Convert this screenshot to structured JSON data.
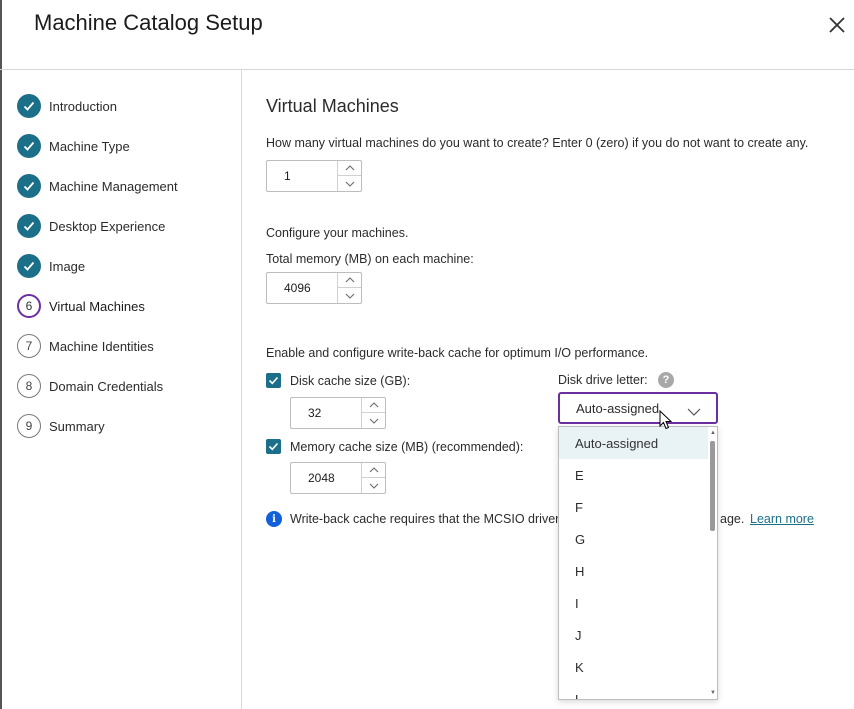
{
  "dialog": {
    "title": "Machine Catalog Setup"
  },
  "steps": [
    {
      "label": "Introduction",
      "state": "done"
    },
    {
      "label": "Machine Type",
      "state": "done"
    },
    {
      "label": "Machine Management",
      "state": "done"
    },
    {
      "label": "Desktop Experience",
      "state": "done"
    },
    {
      "label": "Image",
      "state": "done"
    },
    {
      "label": "Virtual Machines",
      "state": "current",
      "number": "6"
    },
    {
      "label": "Machine Identities",
      "state": "todo",
      "number": "7"
    },
    {
      "label": "Domain Credentials",
      "state": "todo",
      "number": "8"
    },
    {
      "label": "Summary",
      "state": "todo",
      "number": "9"
    }
  ],
  "main": {
    "title": "Virtual Machines",
    "vm_question": "How many virtual machines do you want to create? Enter 0 (zero) if you do not want to create any.",
    "vm_count": "1",
    "configure_label": "Configure your machines.",
    "memory_label": "Total memory (MB) on each machine:",
    "memory_value": "4096",
    "cache_intro": "Enable and configure write-back cache for optimum I/O performance.",
    "disk_cache_label": "Disk cache size (GB):",
    "disk_cache_checked": true,
    "disk_cache_value": "32",
    "memory_cache_label": "Memory cache size (MB) (recommended):",
    "memory_cache_checked": true,
    "memory_cache_value": "2048",
    "drive_letter_label": "Disk drive letter:",
    "help_glyph": "?",
    "drive_letter_value": "Auto-assigned",
    "drive_letter_options": [
      "Auto-assigned",
      "E",
      "F",
      "G",
      "H",
      "I",
      "J",
      "K",
      "L"
    ],
    "info_glyph": "i",
    "info_text_left": "Write-back cache requires that the MCSIO driver",
    "info_text_right": "age.",
    "learn_more": "Learn more"
  },
  "colors": {
    "accent_teal": "#1b6f88",
    "focus_purple": "#6b2fa0",
    "info_blue": "#1260d9"
  }
}
